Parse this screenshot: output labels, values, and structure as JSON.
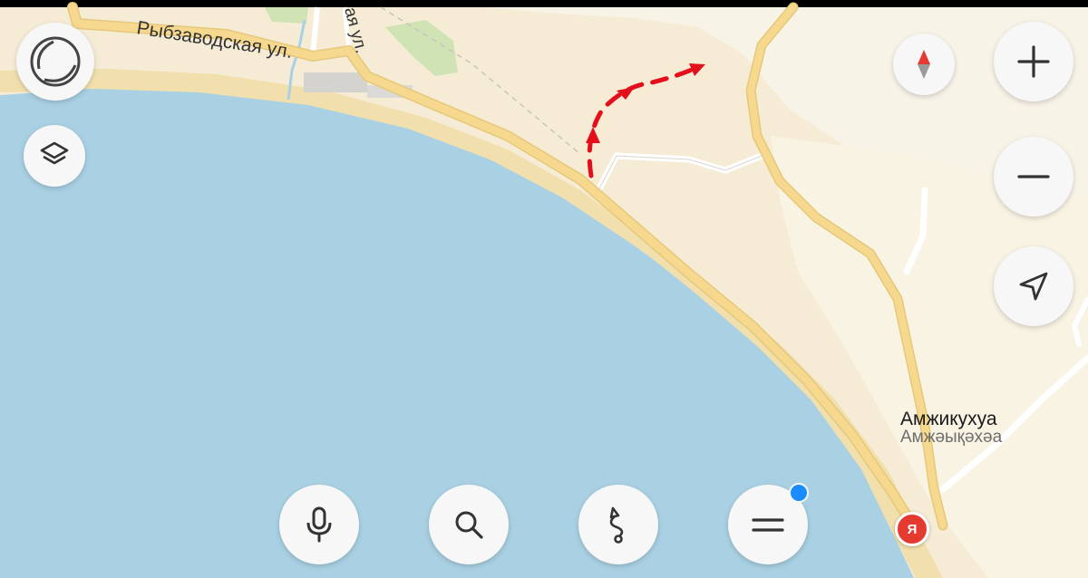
{
  "map": {
    "street_labels": {
      "rybzavodskaya": "Рыбзаводская ул.",
      "partial_street": "ая ул."
    },
    "place": {
      "name": "Амжикухуа",
      "name_alt": "Амжәықәхәа"
    },
    "route_arrow_color": "#e3101c",
    "water_color": "#a9d1e3",
    "land_color": "#f6ecd6",
    "road_color": "#f6d98e",
    "pin": {
      "letter": "Я",
      "color": "#e53a2f"
    }
  },
  "controls": {
    "left": [
      {
        "name": "profile-button",
        "icon": "profile-circle-icon"
      },
      {
        "name": "layers-button",
        "icon": "layers-icon"
      }
    ],
    "right": [
      {
        "name": "compass-button",
        "icon": "compass-icon"
      },
      {
        "name": "zoom-in-button",
        "icon": "plus-icon"
      },
      {
        "name": "zoom-out-button",
        "icon": "minus-icon"
      },
      {
        "name": "my-location-button",
        "icon": "navigation-arrow-icon"
      }
    ],
    "bottom": [
      {
        "name": "voice-button",
        "icon": "microphone-icon"
      },
      {
        "name": "search-button",
        "icon": "search-icon"
      },
      {
        "name": "routes-button",
        "icon": "route-icon"
      },
      {
        "name": "menu-button",
        "icon": "menu-icon",
        "notification": true
      }
    ]
  }
}
